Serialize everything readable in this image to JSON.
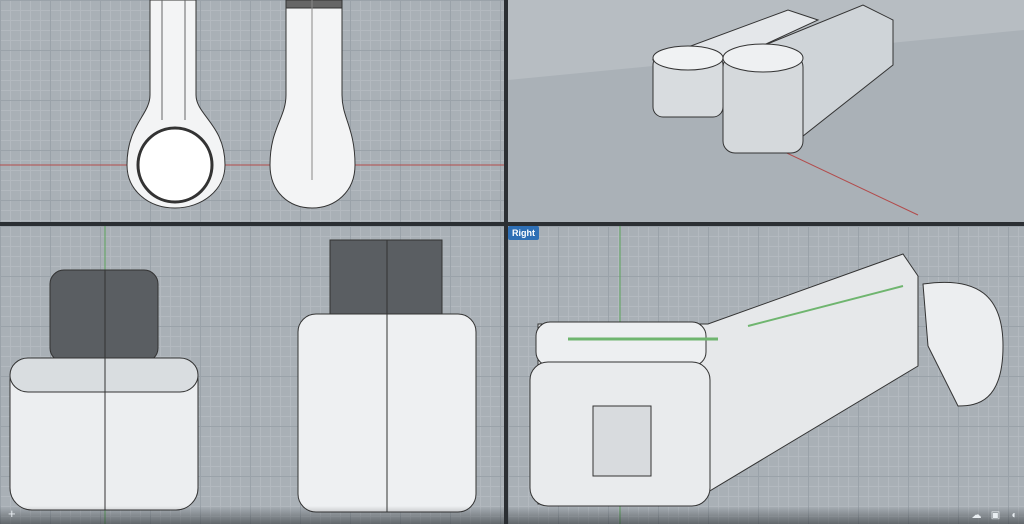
{
  "viewports": {
    "right": {
      "label": "Right"
    }
  },
  "status_bar": {
    "plus_symbol": "+",
    "icons": [
      "cloud-upload-icon",
      "panel-layout-icon",
      "display-mode-icon"
    ]
  },
  "colors": {
    "viewport_bg": "#a9b0b6",
    "grid": "#9aa2a9",
    "label_bg": "#2e6fb5",
    "axis_red": "#b24b4b",
    "axis_green": "#5aa35a"
  }
}
